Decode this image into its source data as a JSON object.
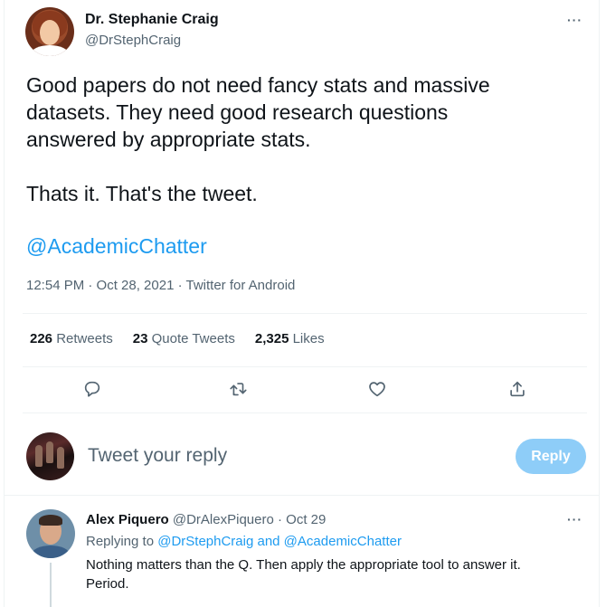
{
  "tweet": {
    "author": {
      "name": "Dr. Stephanie Craig",
      "handle": "@DrStephCraig"
    },
    "text": "Good papers do not need fancy stats and massive\ndatasets. They need good research questions\nanswered by appropriate stats.\n\nThats it. That's the tweet.",
    "mention": "@AcademicChatter",
    "meta": "12:54 PM · Oct 28, 2021 · Twitter for Android",
    "more": "···",
    "stats": {
      "retweets_count": "226",
      "retweets_label": "Retweets",
      "quotes_count": "23",
      "quotes_label": "Quote Tweets",
      "likes_count": "2,325",
      "likes_label": "Likes"
    }
  },
  "compose": {
    "placeholder": "Tweet your reply",
    "button": "Reply"
  },
  "reply": {
    "author_name": "Alex Piquero",
    "author_handle": "@DrAlexPiquero",
    "sep": "·",
    "date": "Oct 29",
    "replying_prefix": "Replying to",
    "replying_to": "@DrStephCraig and @AcademicChatter",
    "text": "Nothing matters than the Q. Then apply the appropriate tool to answer it.\nPeriod.",
    "more": "···"
  },
  "icons": [
    "reply-icon",
    "retweet-icon",
    "like-icon",
    "share-icon",
    "more-icon"
  ],
  "colors": {
    "accent": "#1d9bf0",
    "reply_button": "#8ecdf8",
    "muted": "#536471",
    "divider": "#eff3f4"
  }
}
